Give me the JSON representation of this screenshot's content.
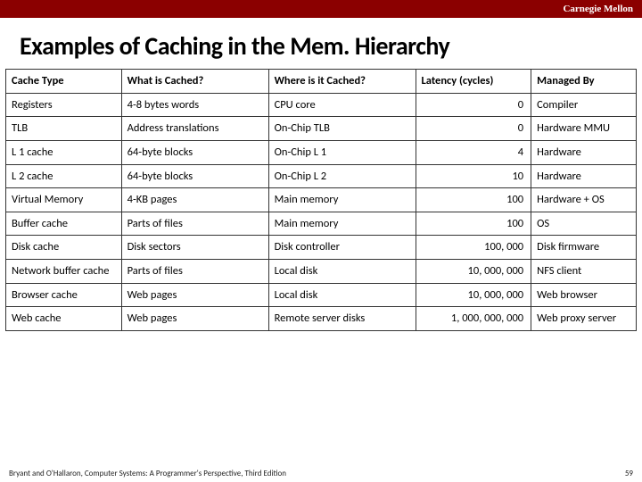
{
  "brand": "Carnegie Mellon",
  "title": "Examples of Caching in the Mem. Hierarchy",
  "columns": [
    "Cache Type",
    "What is Cached?",
    "Where is it Cached?",
    "Latency (cycles)",
    "Managed By"
  ],
  "rows": [
    {
      "type": "Registers",
      "what": "4-8 bytes words",
      "where": " CPU core",
      "latency": "0",
      "by": "Compiler"
    },
    {
      "type": "TLB",
      "what": "Address translations",
      "where": "On-Chip TLB",
      "latency": "0",
      "by": "Hardware MMU"
    },
    {
      "type": "L 1 cache",
      "what": "64-byte blocks",
      "where": "On-Chip L 1",
      "latency": "4",
      "by": "Hardware"
    },
    {
      "type": "L 2 cache",
      "what": "64-byte blocks",
      "where": "On-Chip L 2",
      "latency": "10",
      "by": "Hardware"
    },
    {
      "type": "Virtual Memory",
      "what": "4-KB pages",
      "where": "Main memory",
      "latency": "100",
      "by": "Hardware + OS"
    },
    {
      "type": "Buffer cache",
      "what": "Parts of files",
      "where": "Main memory",
      "latency": "100",
      "by": "OS"
    },
    {
      "type": "Disk cache",
      "what": "Disk sectors",
      "where": "Disk controller",
      "latency": "100, 000",
      "by": "Disk firmware"
    },
    {
      "type": "Network buffer cache",
      "what": "Parts of files",
      "where": "Local disk",
      "latency": "10, 000, 000",
      "by": "NFS client"
    },
    {
      "type": "Browser cache",
      "what": "Web pages",
      "where": "Local disk",
      "latency": "10, 000, 000",
      "by": "Web browser"
    },
    {
      "type": "Web cache",
      "what": "Web pages",
      "where": "Remote server disks",
      "latency": "1, 000, 000, 000",
      "by": "Web proxy server"
    }
  ],
  "footer_left": "Bryant and O'Hallaron, Computer Systems: A Programmer's Perspective, Third Edition",
  "footer_right": "59"
}
